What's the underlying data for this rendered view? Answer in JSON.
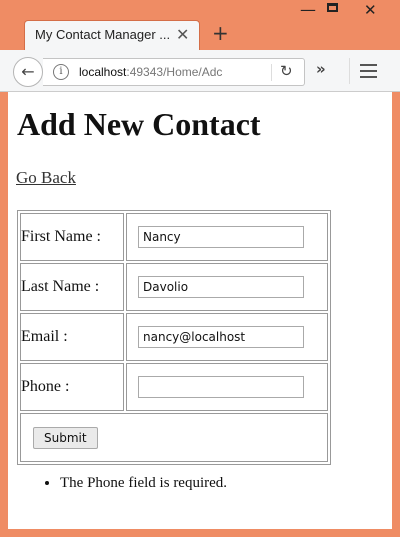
{
  "browser": {
    "tab_title": "My Contact Manager ...",
    "url_host": "localhost",
    "url_rest": ":49343/Home/Adc"
  },
  "page": {
    "heading": "Add New Contact",
    "go_back": "Go Back",
    "fields": [
      {
        "label": "First Name :",
        "value": "Nancy"
      },
      {
        "label": "Last Name :",
        "value": "Davolio"
      },
      {
        "label": "Email :",
        "value": "nancy@localhost"
      },
      {
        "label": "Phone :",
        "value": ""
      }
    ],
    "submit_label": "Submit",
    "errors": [
      "The Phone field is required."
    ]
  }
}
